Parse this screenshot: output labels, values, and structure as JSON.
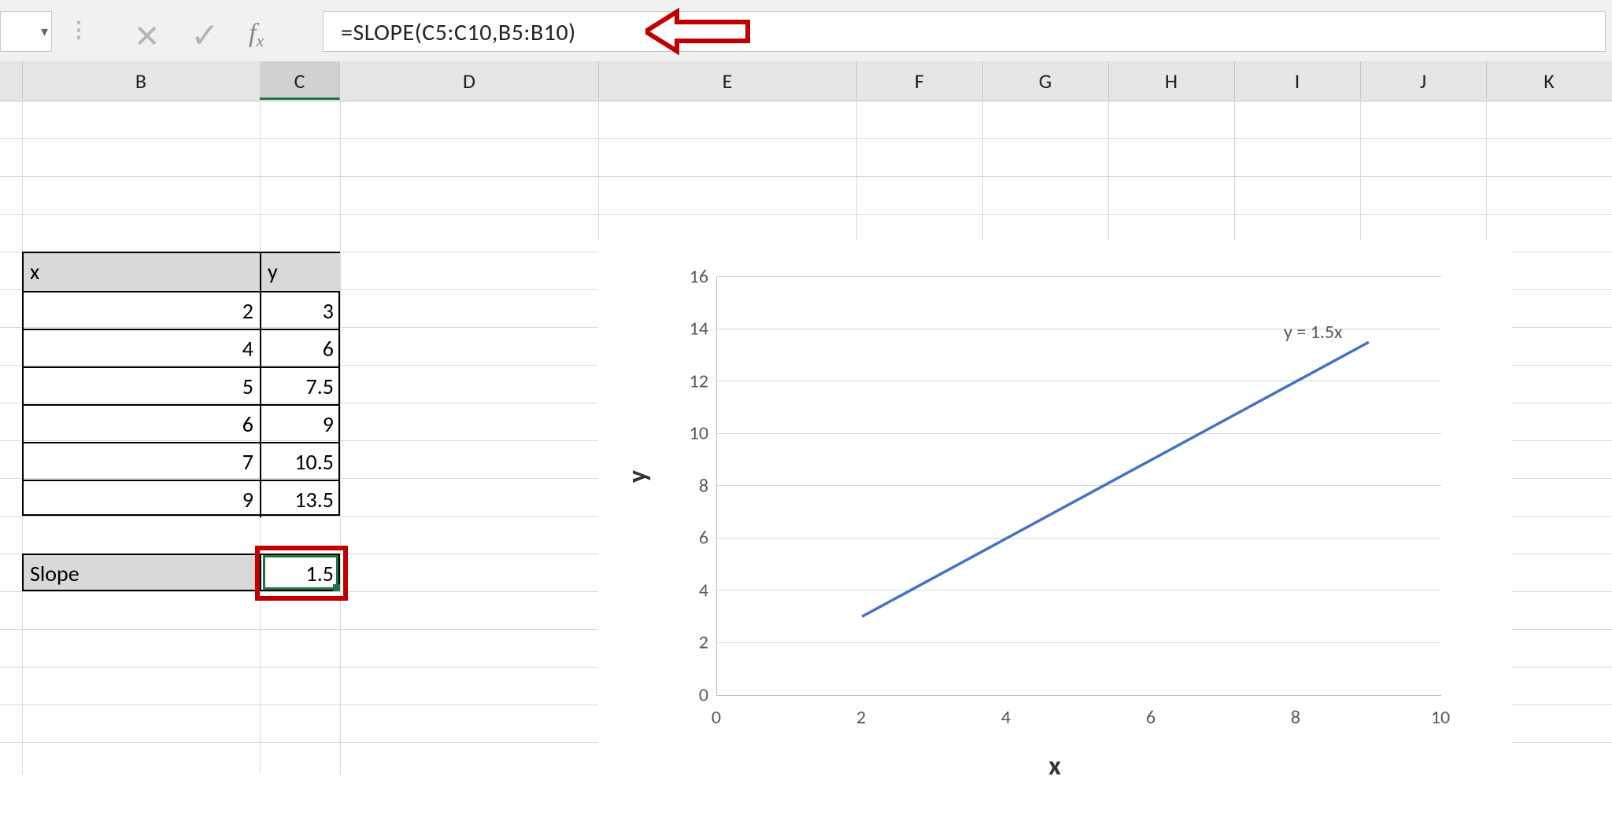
{
  "formula_bar": {
    "formula": "=SLOPE(C5:C10,B5:B10)"
  },
  "columns": {
    "B": "B",
    "C": "C",
    "D": "D",
    "E": "E",
    "F": "F",
    "G": "G",
    "H": "H",
    "I": "I",
    "J": "J",
    "K": "K"
  },
  "table": {
    "header_x": "x",
    "header_y": "y",
    "rows": [
      {
        "x": "2",
        "y": "3"
      },
      {
        "x": "4",
        "y": "6"
      },
      {
        "x": "5",
        "y": "7.5"
      },
      {
        "x": "6",
        "y": "9"
      },
      {
        "x": "7",
        "y": "10.5"
      },
      {
        "x": "9",
        "y": "13.5"
      }
    ]
  },
  "slope": {
    "label": "Slope",
    "value": "1.5"
  },
  "chart_data": {
    "type": "line",
    "x": [
      2,
      4,
      5,
      6,
      7,
      9
    ],
    "y": [
      3,
      6,
      7.5,
      9,
      10.5,
      13.5
    ],
    "xlabel": "x",
    "ylabel": "y",
    "xlim": [
      0,
      10
    ],
    "ylim": [
      0,
      16
    ],
    "x_ticks": [
      0,
      2,
      4,
      6,
      8,
      10
    ],
    "y_ticks": [
      0,
      2,
      4,
      6,
      8,
      10,
      12,
      14,
      16
    ],
    "trendline_equation": "y = 1.5x",
    "series_color": "#4472c4"
  }
}
